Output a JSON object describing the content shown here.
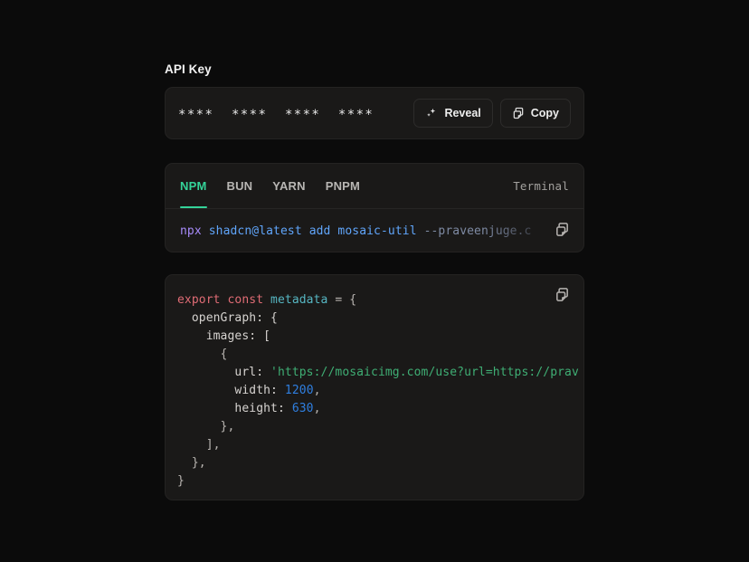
{
  "theme": {
    "page_bg": "#0b0b0b",
    "panel_bg": "#1a1918",
    "panel_border": "#242322",
    "accent": "#34d399",
    "text": "#ededed",
    "muted": "#b8b6b3"
  },
  "api_key": {
    "label": "API Key",
    "masked_value": "****  ****  ****  ****",
    "reveal_button": "Reveal",
    "copy_button": "Copy",
    "reveal_icon": "sparkles-icon",
    "copy_icon": "copy-icon"
  },
  "install": {
    "tabs": [
      {
        "label": "NPM",
        "active": true
      },
      {
        "label": "BUN",
        "active": false
      },
      {
        "label": "YARN",
        "active": false
      },
      {
        "label": "PNPM",
        "active": false
      }
    ],
    "terminal_label": "Terminal",
    "copy_icon": "copy-icon",
    "command": {
      "full": "npx shadcn@latest add mosaic-util --praveenjuge.c",
      "tokens": {
        "bin": "npx",
        "pkg": "shadcn@latest",
        "verb": "add",
        "component": "mosaic-util",
        "flag": "--praveenjuge.c"
      }
    }
  },
  "code_block": {
    "copy_icon": "copy-icon",
    "language": "javascript",
    "lines": {
      "l1_export": "export const",
      "l1_name": " metadata",
      "l1_eq": " = {",
      "l2": "  openGraph: {",
      "l3": "    images: [",
      "l4": "      {",
      "l5_prop": "        url:",
      "l5_str": " 'https://mosaicimg.com/use?url=https://prav",
      "l6_prop": "        width:",
      "l6_num": " 1200",
      "l6_punc": ",",
      "l7_prop": "        height:",
      "l7_num": " 630",
      "l7_punc": ",",
      "l8": "      },",
      "l9": "    ],",
      "l10": "  },",
      "l11": "}"
    }
  }
}
